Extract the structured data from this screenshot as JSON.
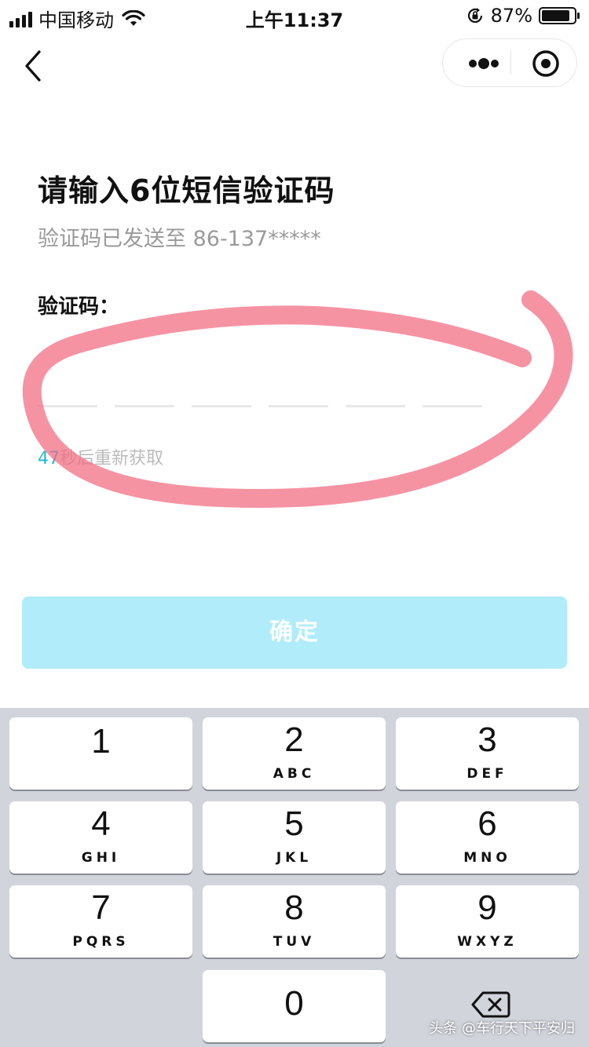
{
  "status_bar": {
    "carrier": "中国移动",
    "time": "上午11:37",
    "battery_percent": "87%",
    "battery_level": 0.87
  },
  "nav": {
    "back_icon": "chevron-left-icon",
    "more_icon": "more-dots-icon",
    "close_icon": "target-close-icon"
  },
  "content": {
    "title": "请输入6位短信验证码",
    "subtitle": "验证码已发送至 86-137*****",
    "code_label": "验证码：",
    "code_length": 6,
    "resend_count": "47",
    "resend_text": "秒后重新获取",
    "confirm_label": "确定"
  },
  "keypad": {
    "keys": [
      {
        "num": "1",
        "letters": ""
      },
      {
        "num": "2",
        "letters": "ABC"
      },
      {
        "num": "3",
        "letters": "DEF"
      },
      {
        "num": "4",
        "letters": "GHI"
      },
      {
        "num": "5",
        "letters": "JKL"
      },
      {
        "num": "6",
        "letters": "MNO"
      },
      {
        "num": "7",
        "letters": "PQRS"
      },
      {
        "num": "8",
        "letters": "TUV"
      },
      {
        "num": "9",
        "letters": "WXYZ"
      },
      {
        "num": "0",
        "letters": ""
      }
    ],
    "delete_icon": "backspace-icon"
  },
  "watermark": "头条 @车行天下平安归",
  "colors": {
    "accent": "#1fb8d8",
    "confirm_bg": "#b0ecfa",
    "scribble": "#f26a7f",
    "keypad_bg": "#d1d4db"
  }
}
